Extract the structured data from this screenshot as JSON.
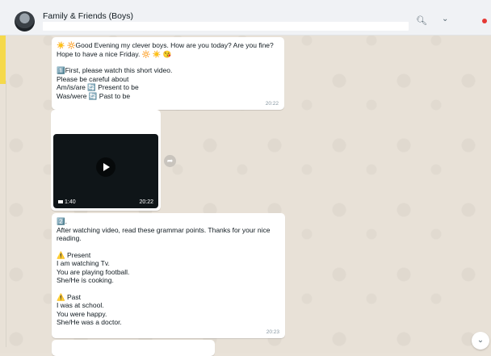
{
  "header": {
    "title": "Family & Friends (Boys)",
    "search_icon": "search-icon",
    "menu_icon": "chevron-down-icon",
    "status_dot_color": "#e53935"
  },
  "messages": {
    "msg1": {
      "lines": [
        "☀️ 🔆Good Evening my clever boys. How are you today? Are you fine?",
        "Hope to have a nice Friday. 🔆 ☀️ 😘",
        "",
        "1️⃣First, please watch this short video.",
        "Please be careful about",
        "Am/is/are 🔄 Present to be",
        "Was/were 🔄 Past to be"
      ],
      "time": "20:22"
    },
    "video": {
      "duration": "1:40",
      "time": "20:22"
    },
    "msg3": {
      "badge": "2️⃣.",
      "intro1": "After watching video, read these grammar points. Thanks for your nice",
      "intro2": "reading.",
      "present_heading": "⚠️ Present",
      "present_lines": [
        "I am watching Tv.",
        "You are playing football.",
        "She/He is cooking."
      ],
      "past_heading": "⚠️ Past",
      "past_lines": [
        "I was at school.",
        "You were happy.",
        "She/He was a doctor."
      ],
      "time": "20:23"
    }
  }
}
